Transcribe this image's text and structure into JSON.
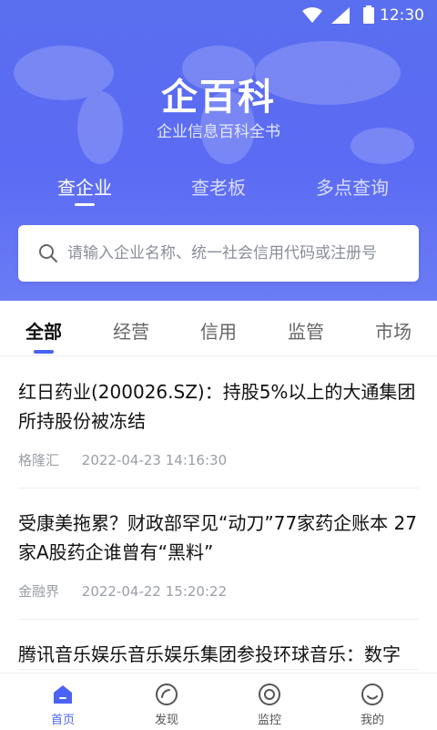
{
  "status_bar": {
    "time": "12:30"
  },
  "header": {
    "title": "企百科",
    "subtitle": "企业信息百科全书"
  },
  "search_tabs": [
    {
      "label": "查企业",
      "active": true
    },
    {
      "label": "查老板",
      "active": false
    },
    {
      "label": "多点查询",
      "active": false
    }
  ],
  "search": {
    "placeholder": "请输入企业名称、统一社会信用代码或注册号"
  },
  "categories": [
    {
      "label": "全部",
      "active": true
    },
    {
      "label": "经营",
      "active": false
    },
    {
      "label": "信用",
      "active": false
    },
    {
      "label": "监管",
      "active": false
    },
    {
      "label": "市场",
      "active": false
    }
  ],
  "news": [
    {
      "headline": "红日药业(200026.SZ)：持股5%以上的大通集团所持股份被冻结",
      "source": "格隆汇",
      "time": "2022-04-23 14:16:30"
    },
    {
      "headline": "受康美拖累？财政部罕见“动刀”77家药企账本 27家A股药企谁曾有“黑料”",
      "source": "金融界",
      "time": "2022-04-22 15:20:22"
    },
    {
      "headline": "腾讯音乐娱乐音乐娱乐集团参投环球音乐：数字",
      "source": "",
      "time": ""
    }
  ],
  "bottom_nav": [
    {
      "label": "首页",
      "icon": "home-icon",
      "active": true
    },
    {
      "label": "发现",
      "icon": "compass-icon",
      "active": false
    },
    {
      "label": "监控",
      "icon": "monitor-icon",
      "active": false
    },
    {
      "label": "我的",
      "icon": "profile-icon",
      "active": false
    }
  ],
  "colors": {
    "primary": "#4b63f5",
    "hero": "#5b6bf3"
  }
}
